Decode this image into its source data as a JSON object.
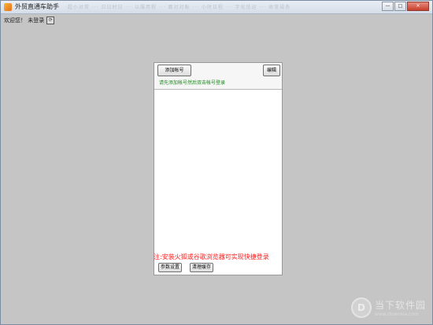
{
  "window": {
    "title": "外贸直通车助手",
    "ghost_tabs": "·超小对常 ··· 日日时日 ··· 以服用程 ··· 面对对账 ··· 小时日程 ··· 字化信运 ··· 收常规务",
    "minimize_glyph": "—",
    "maximize_glyph": "□",
    "close_glyph": "✕"
  },
  "header": {
    "welcome": "欢迎您！ 未登录",
    "refresh_glyph": "⟳"
  },
  "panel": {
    "add_account_label": "添加帐号",
    "edit_label": "编辑",
    "hint": "请先添加帐号然后双击帐号登录",
    "notice": "注:安装火狐或谷歌浏览器可实现快捷登录",
    "settings_label": "参数设置",
    "clear_cache_label": "清理缓存"
  },
  "watermark": {
    "logo_glyph": "D",
    "name": "当下软件园",
    "url": "www.downxia.com"
  },
  "colors": {
    "hint": "#1a8a1a",
    "notice": "#ff1a1a",
    "background": "#c5c5c5"
  }
}
